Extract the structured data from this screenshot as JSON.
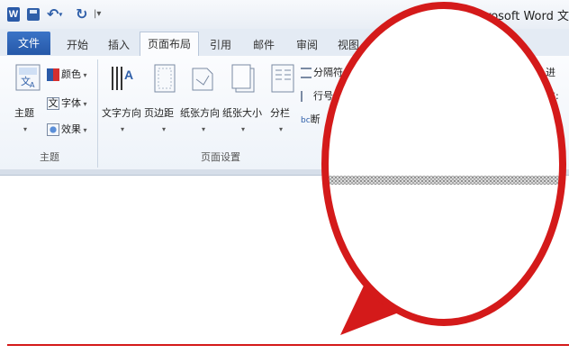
{
  "titlebar": {
    "app_title": "icrosoft Word 文",
    "quick_access": [
      "word-logo-icon",
      "save-icon",
      "undo-icon",
      "redo-icon",
      "customize-dropdown-icon"
    ]
  },
  "tabs": {
    "items": [
      "文件",
      "开始",
      "插入",
      "页面布局",
      "引用",
      "邮件",
      "审阅",
      "视图"
    ],
    "active": "页面布局"
  },
  "ribbon": {
    "theme_group": {
      "label": "主题",
      "big_button_label": "主题",
      "small_buttons": [
        "颜色",
        "字体",
        "效果"
      ]
    },
    "page_setup_group": {
      "label": "页面设置",
      "big_buttons": [
        "文字方向",
        "页边距",
        "纸张方向",
        "纸张大小",
        "分栏"
      ],
      "small_buttons": [
        "分隔符",
        "行号",
        "断"
      ]
    },
    "right_fragments": [
      "进",
      "左:"
    ]
  },
  "colors": {
    "file_tab": "#2658a8",
    "callout_red": "#d41a1a"
  }
}
